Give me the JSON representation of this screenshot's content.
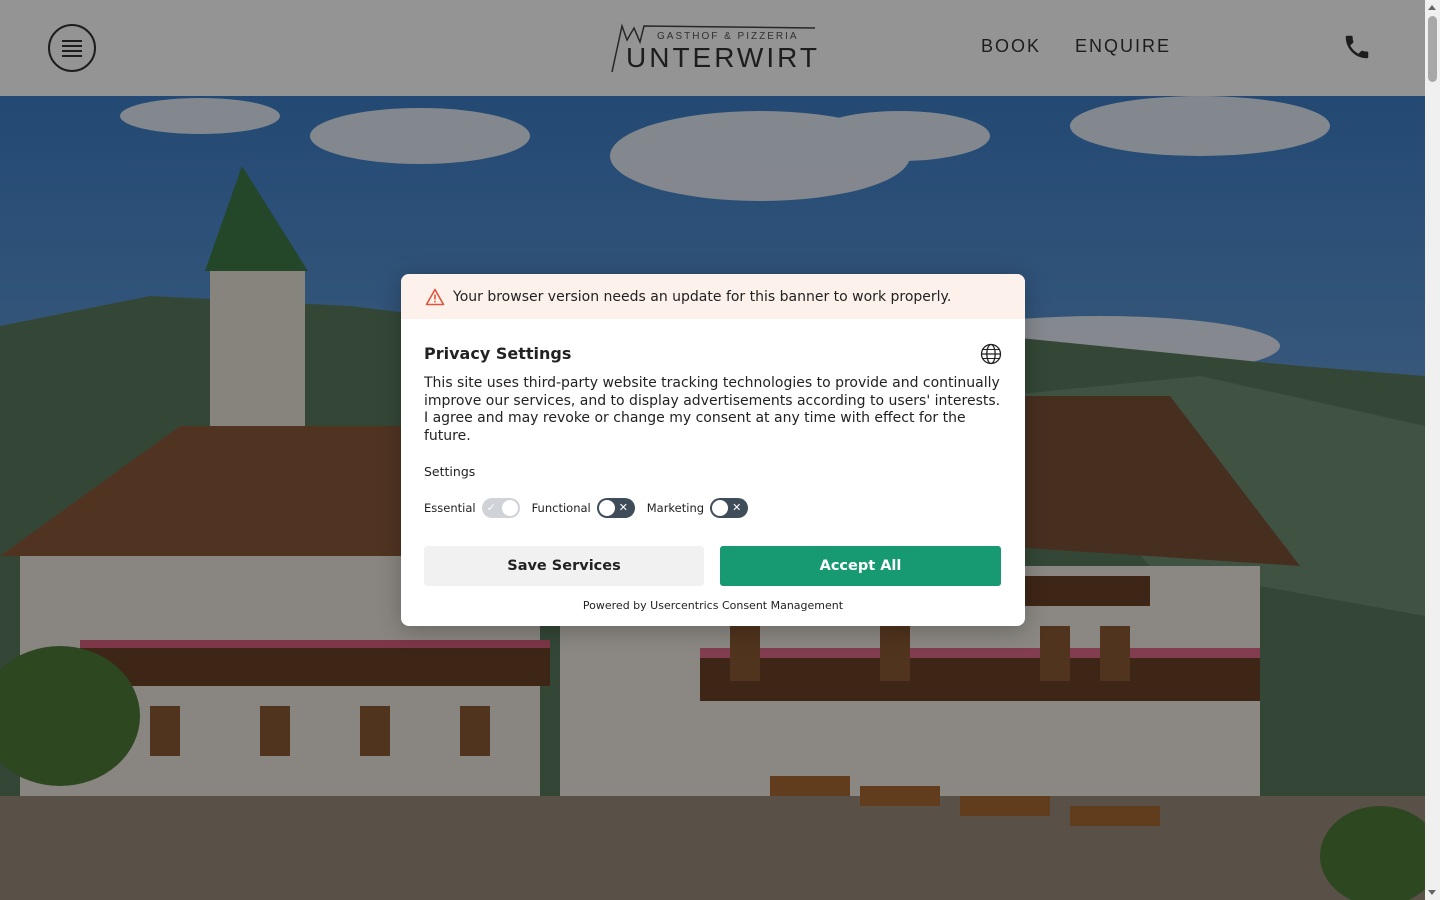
{
  "header": {
    "menu_icon": "hamburger-menu-icon",
    "logo": {
      "subtitle": "GASTHOF & PIZZERIA",
      "name": "UNTERWIRT"
    },
    "nav": {
      "book": "BOOK",
      "enquire": "ENQUIRE"
    },
    "phone_icon": "phone-icon"
  },
  "consent": {
    "warning_icon": "warning-triangle-icon",
    "warning": "Your browser version needs an update for this banner to work properly.",
    "title": "Privacy Settings",
    "globe_icon": "globe-icon",
    "text": "This site uses third-party website tracking technologies to provide and continually improve our services, and to display advertisements according to users' interests. I agree and may revoke or change my consent at any time with effect for the future.",
    "settings_label": "Settings",
    "toggles": [
      {
        "label": "Essential",
        "state": "on",
        "disabled": true
      },
      {
        "label": "Functional",
        "state": "off"
      },
      {
        "label": "Marketing",
        "state": "off"
      }
    ],
    "save_label": "Save Services",
    "accept_label": "Accept All",
    "powered_by": "Powered by Usercentrics Consent Management",
    "colors": {
      "accept": "#179a72",
      "warning_bg": "#fdf1ec",
      "warning_icon": "#e0553a"
    }
  }
}
